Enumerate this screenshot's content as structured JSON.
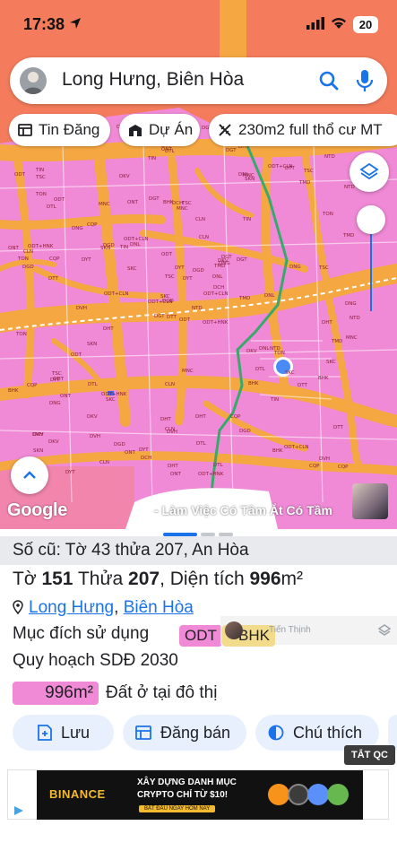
{
  "status_bar": {
    "time": "17:38",
    "battery": "20"
  },
  "search": {
    "text": "Long Hưng, Biên Hòa"
  },
  "chips": [
    {
      "label": "Tin Đăng",
      "icon": "listing-icon"
    },
    {
      "label": "Dự Án",
      "icon": "project-icon"
    },
    {
      "label": "230m2 full thổ cư MT",
      "icon": "ruler-icon"
    }
  ],
  "map": {
    "attribution": "Google",
    "watermark": "- Làm Việc Có Tâm Ắt Có Tầm",
    "colors": {
      "residential": "#f08ad6",
      "roads": "#f5a742",
      "topband": "#f47c5c",
      "green_route": "#3aa86b",
      "water": "#ffffff"
    },
    "zone_labels": [
      "ODT",
      "DTL",
      "DGD",
      "DKV",
      "TMD",
      "SKC",
      "DHT",
      "TSC",
      "MNC",
      "ODT+CLN",
      "ODT+HNK",
      "CQP",
      "DTT",
      "NTD",
      "DGT",
      "TIN",
      "DYT",
      "BHK",
      "CLN",
      "ONT",
      "DNL",
      "SKN",
      "DVH",
      "DCH",
      "DNG",
      "TON"
    ]
  },
  "sheet": {
    "old_parcel": "Số cũ: Tờ 43 thửa 207, An Hòa",
    "sheet_prefix": "Tờ ",
    "sheet_no": "151",
    "plot_prefix": " Thửa ",
    "plot_no": "207",
    "area_prefix": ", Diện tích ",
    "area_value": "996",
    "area_unit": "m²",
    "ward": "Long Hưng",
    "separator": ",",
    "city": "Biên Hòa",
    "purpose_label": "Mục đích sử dụng",
    "purpose_codes": [
      "ODT",
      "BHK"
    ],
    "overlay_name": "Tiến Thịnh",
    "plan_label": "Quy hoạch SDĐ 2030",
    "plan_area": "996m²",
    "plan_desc": "Đất ở tại đô thị"
  },
  "actions": [
    {
      "label": "Lưu",
      "icon": "add-note-icon"
    },
    {
      "label": "Đăng bán",
      "icon": "listing-icon"
    },
    {
      "label": "Chú thích",
      "icon": "contrast-icon"
    }
  ],
  "ad": {
    "close_label": "TẮT QC",
    "brand": "BINANCE",
    "line1": "XÂY DỰNG DANH MỤC",
    "line2": "CRYPTO CHỈ TỪ $10!",
    "cta": "BẮT ĐẦU NGAY HÔM NAY"
  }
}
